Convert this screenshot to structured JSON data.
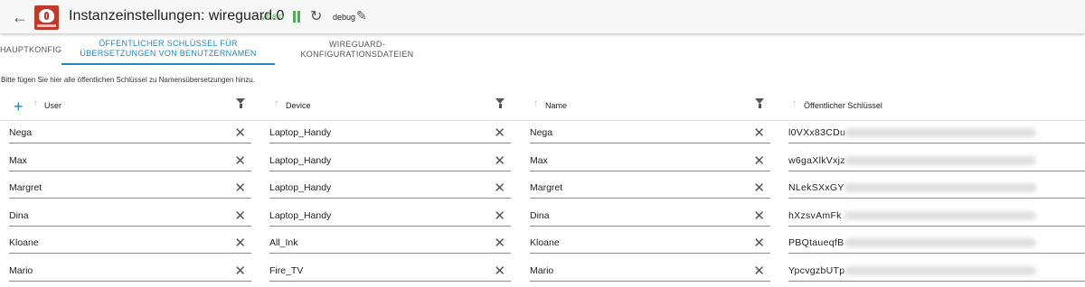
{
  "header": {
    "title": "Instanzeinstellungen: wireguard.0",
    "version": "v1.8.0",
    "log_level": "debug"
  },
  "tabs": [
    {
      "label": "HAUPTKONFIG",
      "active": false
    },
    {
      "label": "ÖFFENTLICHER SCHLÜSSEL FÜR ÜBERSETZUNGEN VON BENUTZERNAMEN",
      "active": true
    },
    {
      "label": "WIREGUARD-KONFIGURATIONSDATEIEN",
      "active": false
    }
  ],
  "hint": "Bitte fügen Sie hier alle öffentlichen Schlüssel zu Namensübersetzungen hinzu.",
  "table": {
    "columns": [
      "User",
      "Device",
      "Name",
      "Öffentlicher Schlüssel"
    ],
    "rows": [
      {
        "user": "Nega",
        "device": "Laptop_Handy",
        "name": "Nega",
        "key": "l0VXx83CDu"
      },
      {
        "user": "Max",
        "device": "Laptop_Handy",
        "name": "Max",
        "key": "w6gaXlkVxjz"
      },
      {
        "user": "Margret",
        "device": "Laptop_Handy",
        "name": "Margret",
        "key": "NLekSXxGY"
      },
      {
        "user": "Dina",
        "device": "Laptop_Handy",
        "name": "Dina",
        "key": "hXzsvAmFk"
      },
      {
        "user": "Kloane",
        "device": "All_Ink",
        "name": "Kloane",
        "key": "PBQtaueqfB"
      },
      {
        "user": "Mario",
        "device": "Fire_TV",
        "name": "Mario",
        "key": "YpcvgzbUTp"
      }
    ]
  },
  "colors": {
    "accent": "#1f86c7",
    "running": "#4caf50",
    "logo": "#c0392b"
  }
}
